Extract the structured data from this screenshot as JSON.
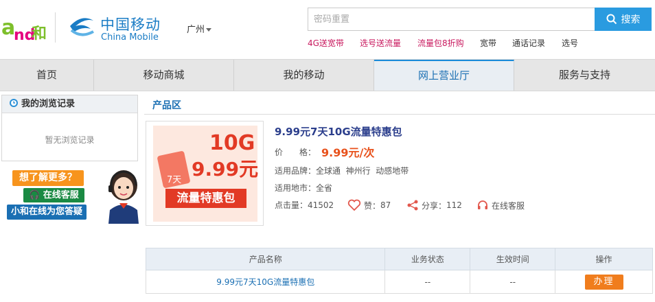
{
  "header": {
    "brand_cn": "中国移动",
    "brand_en": "China Mobile",
    "city": "广州",
    "search": {
      "placeholder": "密码重置",
      "button_label": "搜索"
    },
    "quick_links": [
      "4G送宽带",
      "选号送流量",
      "流量包8折购",
      "宽带",
      "通话记录",
      "选号"
    ]
  },
  "nav": {
    "items": [
      "首页",
      "移动商城",
      "我的移动",
      "网上营业厅",
      "服务与支持"
    ],
    "active": "网上营业厅"
  },
  "sidebar": {
    "history_title": "我的浏览记录",
    "history_empty": "暂无浏览记录",
    "banner": {
      "line1": "想了解更多？",
      "line2": "在线客服",
      "line3": "小和在线为您答疑"
    }
  },
  "product_section": {
    "title": "产品区",
    "image_text": {
      "data": "10G",
      "price": "9.99元",
      "days": "7天",
      "band": "流量特惠包"
    },
    "name": "9.99元7天10G流量特惠包",
    "price_label": "价　　格：",
    "price_value": "9.99元/次",
    "brand_label": "适用品牌：",
    "brand_value": "全球通  神州行  动感地带",
    "area_label": "适用地市：",
    "area_value": "全省",
    "clicks_label": "点击量：",
    "clicks_value": "41502",
    "likes_label": "赞：",
    "likes_value": "87",
    "share_label": "分享：",
    "share_value": "112",
    "service_label": "在线客服"
  },
  "table": {
    "headers": [
      "产品名称",
      "业务状态",
      "生效时间",
      "操作"
    ],
    "row": {
      "name": "9.99元7天10G流量特惠包",
      "status": "--",
      "effective": "--",
      "action": "办理"
    }
  },
  "colors": {
    "brand_blue": "#1a7cc5",
    "accent_orange": "#f07d1d",
    "price_red": "#e8511b",
    "link_pink": "#c8175d",
    "and_green": "#7dbf2b"
  }
}
